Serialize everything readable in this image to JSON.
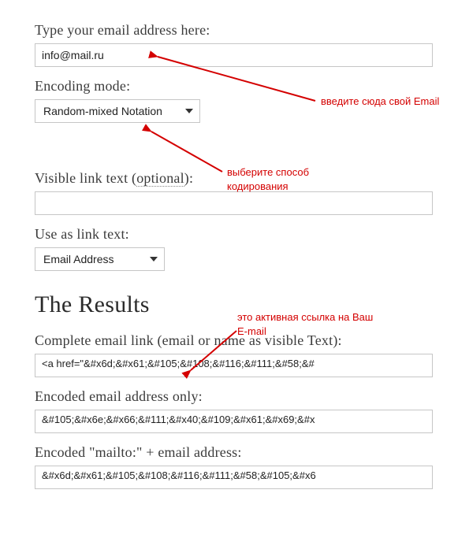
{
  "form": {
    "email_label": "Type your email address here:",
    "email_value": "info@mail.ru",
    "encoding_label": "Encoding mode:",
    "encoding_selected": "Random-mixed Notation",
    "visible_text_label_pre": "Visible link text (",
    "visible_text_optional": "optional",
    "visible_text_label_post": "):",
    "visible_text_value": "",
    "use_as_label": "Use as link text:",
    "use_as_selected": "Email Address"
  },
  "results": {
    "heading": "The Results",
    "complete_label": "Complete email link (email or name as visible Text):",
    "complete_value": "<a href=\"&#x6d;&#x61;&#105;&#108;&#116;&#111;&#58;&#",
    "encoded_only_label": "Encoded email address only:",
    "encoded_only_value": "&#105;&#x6e;&#x66;&#111;&#x40;&#109;&#x61;&#x69;&#x",
    "mailto_label": "Encoded \"mailto:\" + email address:",
    "mailto_value": "&#x6d;&#x61;&#105;&#108;&#116;&#111;&#58;&#105;&#x6"
  },
  "annotations": {
    "a_email": "введите сюда свой Email",
    "a_encode": "выберите способ кодирования",
    "a_result": "это активная ссылка на Ваш E-mail"
  }
}
